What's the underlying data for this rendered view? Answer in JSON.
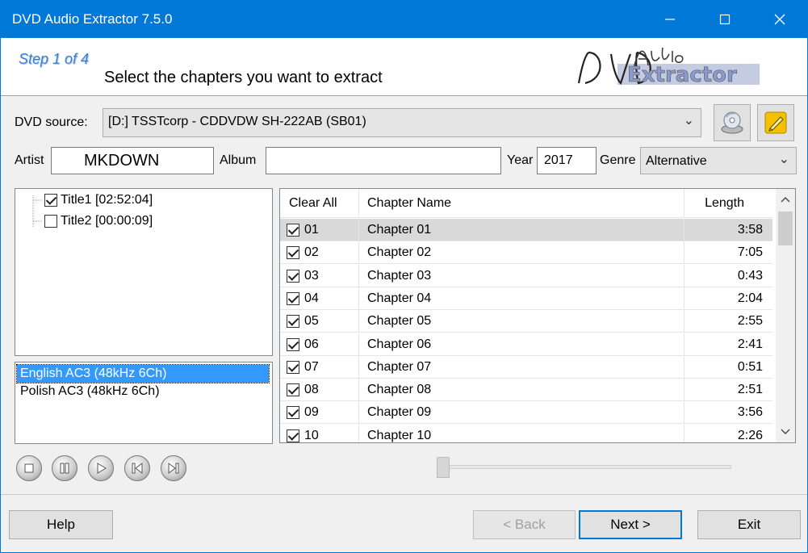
{
  "window": {
    "title": "DVD Audio Extractor 7.5.0"
  },
  "header": {
    "step": "Step 1 of 4",
    "subtitle": "Select the chapters you want to extract"
  },
  "source": {
    "label": "DVD source:",
    "value": "[D:]  TSSTcorp - CDDVDW SH-222AB  (SB01)"
  },
  "meta": {
    "artist_label": "Artist",
    "artist_value": "MKDOWN",
    "album_label": "Album",
    "album_value": "",
    "year_label": "Year",
    "year_value": "2017",
    "genre_label": "Genre",
    "genre_value": "Alternative"
  },
  "titles": [
    {
      "label": "Title1 [02:52:04]",
      "checked": true
    },
    {
      "label": "Title2 [00:00:09]",
      "checked": false
    }
  ],
  "audio_tracks": [
    {
      "label": "English AC3 (48kHz 6Ch)",
      "selected": true
    },
    {
      "label": "Polish AC3 (48kHz 6Ch)",
      "selected": false
    }
  ],
  "grid": {
    "col_clear_all": "Clear All",
    "col_chapter_name": "Chapter Name",
    "col_length": "Length",
    "rows": [
      {
        "num": "01",
        "name": "Chapter 01",
        "length": "3:58",
        "checked": true,
        "selected": true
      },
      {
        "num": "02",
        "name": "Chapter 02",
        "length": "7:05",
        "checked": true
      },
      {
        "num": "03",
        "name": "Chapter 03",
        "length": "0:43",
        "checked": true
      },
      {
        "num": "04",
        "name": "Chapter 04",
        "length": "2:04",
        "checked": true
      },
      {
        "num": "05",
        "name": "Chapter 05",
        "length": "2:55",
        "checked": true
      },
      {
        "num": "06",
        "name": "Chapter 06",
        "length": "2:41",
        "checked": true
      },
      {
        "num": "07",
        "name": "Chapter 07",
        "length": "0:51",
        "checked": true
      },
      {
        "num": "08",
        "name": "Chapter 08",
        "length": "2:51",
        "checked": true
      },
      {
        "num": "09",
        "name": "Chapter 09",
        "length": "3:56",
        "checked": true
      },
      {
        "num": "10",
        "name": "Chapter 10",
        "length": "2:26",
        "checked": true
      }
    ]
  },
  "playback": {
    "position": 0
  },
  "buttons": {
    "help": "Help",
    "back": "< Back",
    "next": "Next >",
    "exit": "Exit"
  },
  "colors": {
    "accent": "#0078d7",
    "selection": "#3399ff",
    "edit_icon": "#f5c000"
  }
}
